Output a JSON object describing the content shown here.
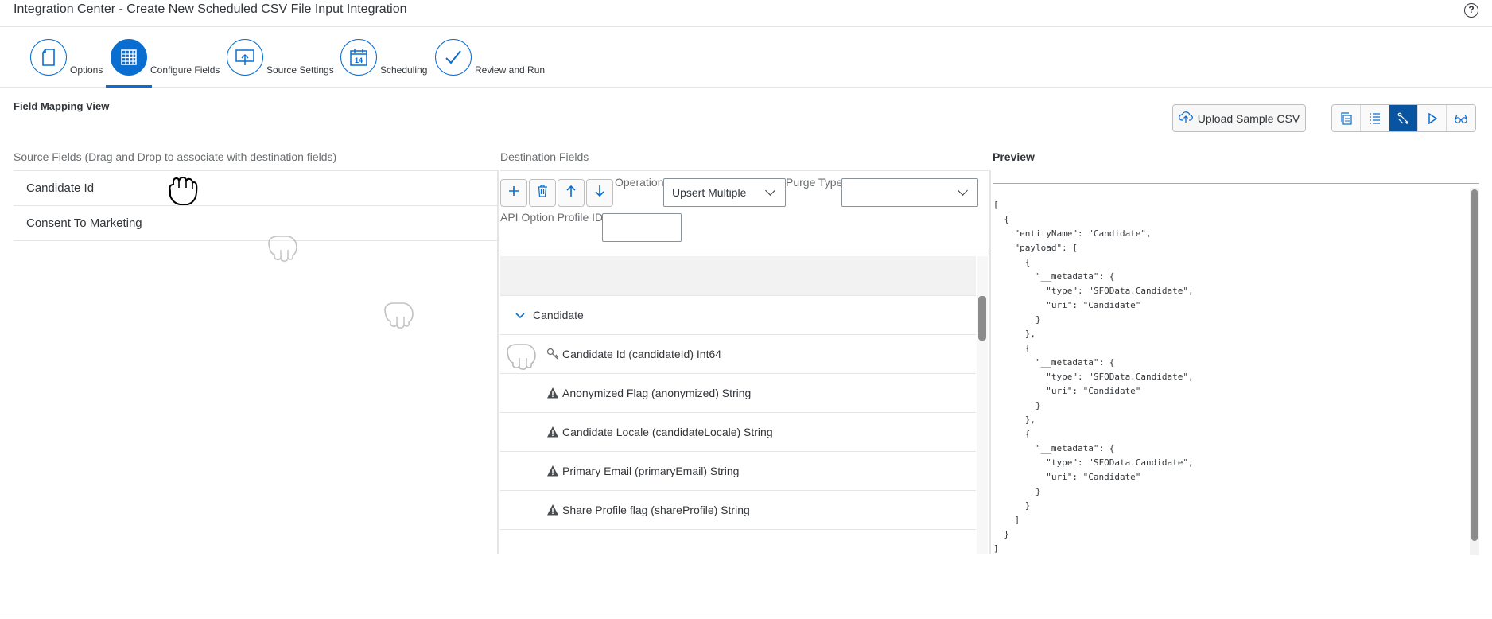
{
  "app": {
    "title": "Integration Center - Create New Scheduled CSV File Input Integration",
    "help_icon": "question-icon",
    "help_glyph": "?"
  },
  "wizard": {
    "steps": [
      {
        "label": "Options",
        "icon": "document-icon",
        "active": false
      },
      {
        "label": "Configure Fields",
        "icon": "table-grid-icon",
        "active": true
      },
      {
        "label": "Source Settings",
        "icon": "upload-screen-icon",
        "active": false
      },
      {
        "label": "Scheduling",
        "icon": "calendar-icon",
        "active": false
      },
      {
        "label": "Review and Run",
        "icon": "checkmark-icon",
        "active": false
      }
    ],
    "calendar_day": "14"
  },
  "mapping": {
    "title": "Field Mapping View",
    "upload_button": "Upload Sample CSV",
    "view_buttons": [
      {
        "icon": "copy-document-icon",
        "active": false
      },
      {
        "icon": "list-icon",
        "active": false
      },
      {
        "icon": "mapping-link-icon",
        "active": true
      },
      {
        "icon": "play-icon",
        "active": false
      },
      {
        "icon": "glasses-icon",
        "active": false
      }
    ]
  },
  "source": {
    "header": "Source Fields (Drag and Drop to associate with destination fields)",
    "fields": [
      "Candidate Id",
      "Consent To Marketing"
    ]
  },
  "destination": {
    "header": "Destination Fields",
    "toolbar": [
      "add-icon",
      "delete-icon",
      "arrow-up-icon",
      "arrow-down-icon"
    ],
    "operation_label": "Operation",
    "operation_value": "Upsert Multiple",
    "purge_label": "Purge Type",
    "purge_value": "",
    "api_option_label": "API Option Profile ID",
    "api_option_value": "",
    "group": "Candidate",
    "rows": [
      {
        "label": "Candidate Id (candidateId) Int64",
        "icon": "key-icon"
      },
      {
        "label": "Anonymized Flag (anonymized) String",
        "icon": "warning-icon"
      },
      {
        "label": "Candidate Locale (candidateLocale) String",
        "icon": "warning-icon"
      },
      {
        "label": "Primary Email (primaryEmail) String",
        "icon": "warning-icon"
      },
      {
        "label": "Share Profile flag (shareProfile) String",
        "icon": "warning-icon"
      }
    ]
  },
  "preview": {
    "header": "Preview",
    "code": "[\n  {\n    \"entityName\": \"Candidate\",\n    \"payload\": [\n      {\n        \"__metadata\": {\n          \"type\": \"SFOData.Candidate\",\n          \"uri\": \"Candidate\"\n        }\n      },\n      {\n        \"__metadata\": {\n          \"type\": \"SFOData.Candidate\",\n          \"uri\": \"Candidate\"\n        }\n      },\n      {\n        \"__metadata\": {\n          \"type\": \"SFOData.Candidate\",\n          \"uri\": \"Candidate\"\n        }\n      }\n    ]\n  }\n]"
  },
  "colors": {
    "accent": "#0a6ed1",
    "active_toggle": "#0854a0",
    "text": "#32363a",
    "muted": "#6a6d70"
  }
}
